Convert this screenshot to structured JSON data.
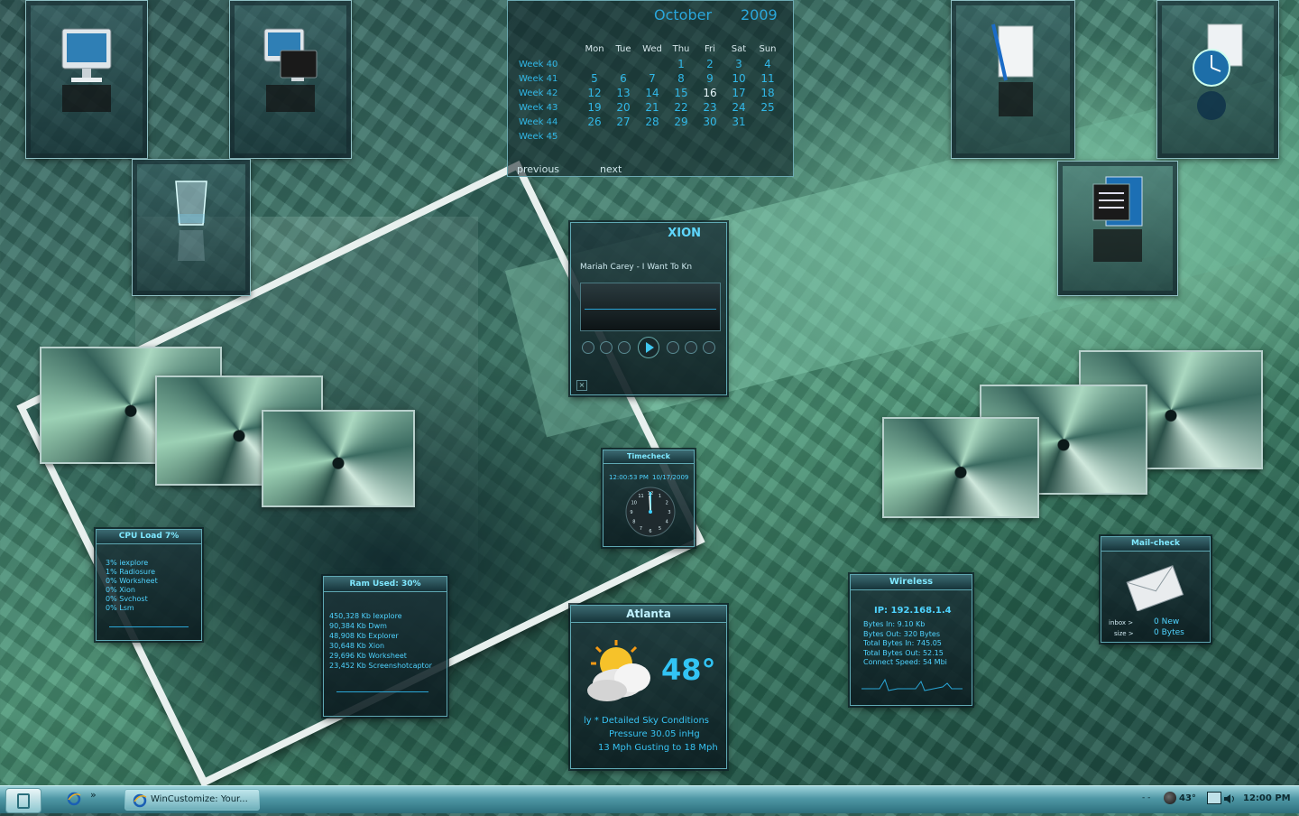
{
  "calendar": {
    "month": "October",
    "year": "2009",
    "weekdays": [
      "Mon",
      "Tue",
      "Wed",
      "Thu",
      "Fri",
      "Sat",
      "Sun"
    ],
    "weeks": [
      {
        "label": "Week 40",
        "days": [
          "",
          "",
          "",
          "1",
          "2",
          "3",
          "4"
        ]
      },
      {
        "label": "Week 41",
        "days": [
          "5",
          "6",
          "7",
          "8",
          "9",
          "10",
          "11"
        ]
      },
      {
        "label": "Week 42",
        "days": [
          "12",
          "13",
          "14",
          "15",
          "16",
          "17",
          "18"
        ]
      },
      {
        "label": "Week 43",
        "days": [
          "19",
          "20",
          "21",
          "22",
          "23",
          "24",
          "25"
        ]
      },
      {
        "label": "Week 44",
        "days": [
          "26",
          "27",
          "28",
          "29",
          "30",
          "31",
          ""
        ]
      },
      {
        "label": "Week 45",
        "days": [
          "",
          "",
          "",
          "",
          "",
          "",
          ""
        ]
      }
    ],
    "today": "16",
    "prev_label": "previous",
    "next_label": "next"
  },
  "player": {
    "title": "XION",
    "track": "Mariah Carey - I Want To Kn"
  },
  "clock": {
    "title": "Timecheck",
    "time": "12:00:53 PM",
    "date": "10/17/2009",
    "numbers": [
      "12",
      "1",
      "2",
      "3",
      "4",
      "5",
      "6",
      "7",
      "8",
      "9",
      "10",
      "11"
    ]
  },
  "cpu": {
    "title": "CPU Load 7%",
    "items": [
      "3% iexplore",
      "1% Radiosure",
      "0% Worksheet",
      "0% Xion",
      "0% Svchost",
      "0% Lsm"
    ]
  },
  "ram": {
    "title": "Ram Used: 30%",
    "items": [
      "450,328 Kb Iexplore",
      "90,384 Kb Dwm",
      "48,908 Kb Explorer",
      "30,648 Kb Xion",
      "29,696 Kb Worksheet",
      "23,452 Kb Screenshotcaptor"
    ]
  },
  "weather": {
    "city": "Atlanta",
    "temp": "48°",
    "conditions": "ly * Detailed Sky Conditions",
    "pressure": "Pressure 30.05 inHg",
    "wind": "13 Mph Gusting to 18 Mph"
  },
  "wireless": {
    "title": "Wireless",
    "ip": "IP: 192.168.1.4",
    "lines": [
      "Bytes In: 9.10 Kb",
      "Bytes Out: 320 Bytes",
      "Total Bytes In: 745.05",
      "Total Bytes Out: 52.15",
      "Connect Speed: 54 Mbi"
    ]
  },
  "mail": {
    "title": "Mail-check",
    "inbox_label": "inbox >",
    "size_label": "size >",
    "new_count": "0 New",
    "size_value": "0 Bytes"
  },
  "taskbar": {
    "window_label": "WinCustomize: Your...",
    "chevron": "»",
    "tray_temp": "43°",
    "clock": "12:00 PM",
    "tray_dots": "- -"
  }
}
